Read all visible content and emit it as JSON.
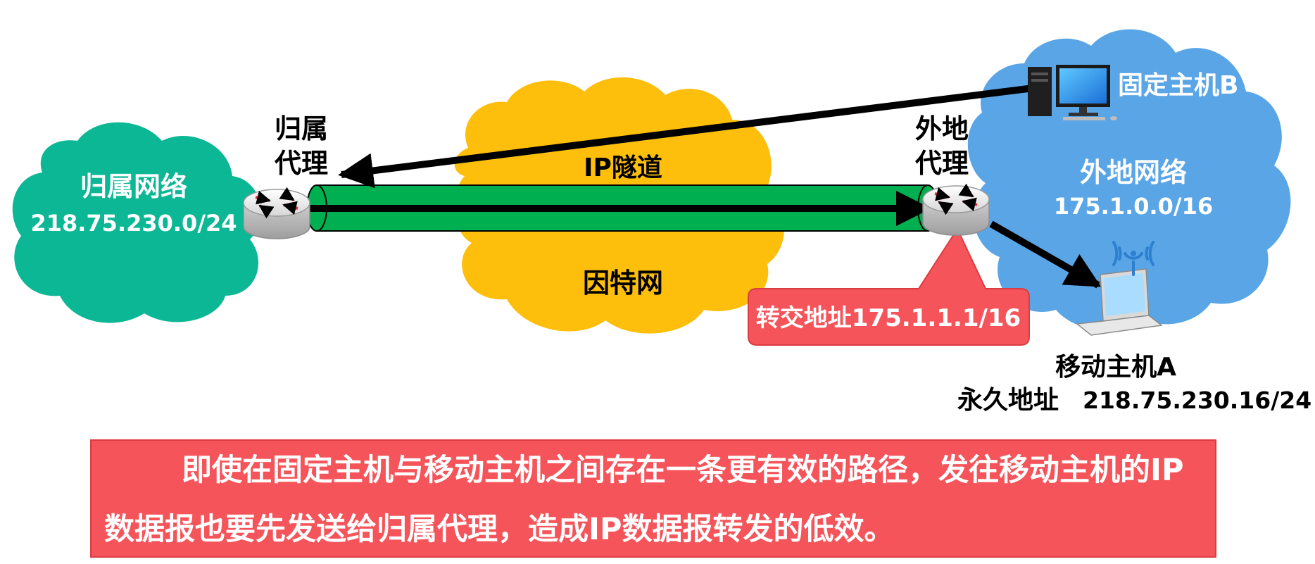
{
  "home_network": {
    "name": "归属网络",
    "subnet": "218.75.230.0/24",
    "color": "#0bb795"
  },
  "home_agent": {
    "line1": "归属",
    "line2": "代理"
  },
  "internet": {
    "name": "因特网",
    "tunnel_label": "IP隧道",
    "cloud_color": "#fdbf0b",
    "tunnel_color": "#00b050"
  },
  "foreign_agent": {
    "line1": "外地",
    "line2": "代理"
  },
  "foreign_network": {
    "name": "外地网络",
    "subnet": "175.1.0.0/16",
    "color": "#5aa5e6"
  },
  "fixed_host": {
    "name": "固定主机B"
  },
  "care_of_address": {
    "label": "转交地址175.1.1.1/16",
    "color": "#f5545a"
  },
  "mobile_host": {
    "name": "移动主机A",
    "permanent_address_label": "永久地址",
    "permanent_address": "218.75.230.16/24"
  },
  "note": {
    "text": "即使在固定主机与移动主机之间存在一条更有效的路径，发往移动主机的IP数据报也要先发送给归属代理，造成IP数据报转发的低效。"
  }
}
